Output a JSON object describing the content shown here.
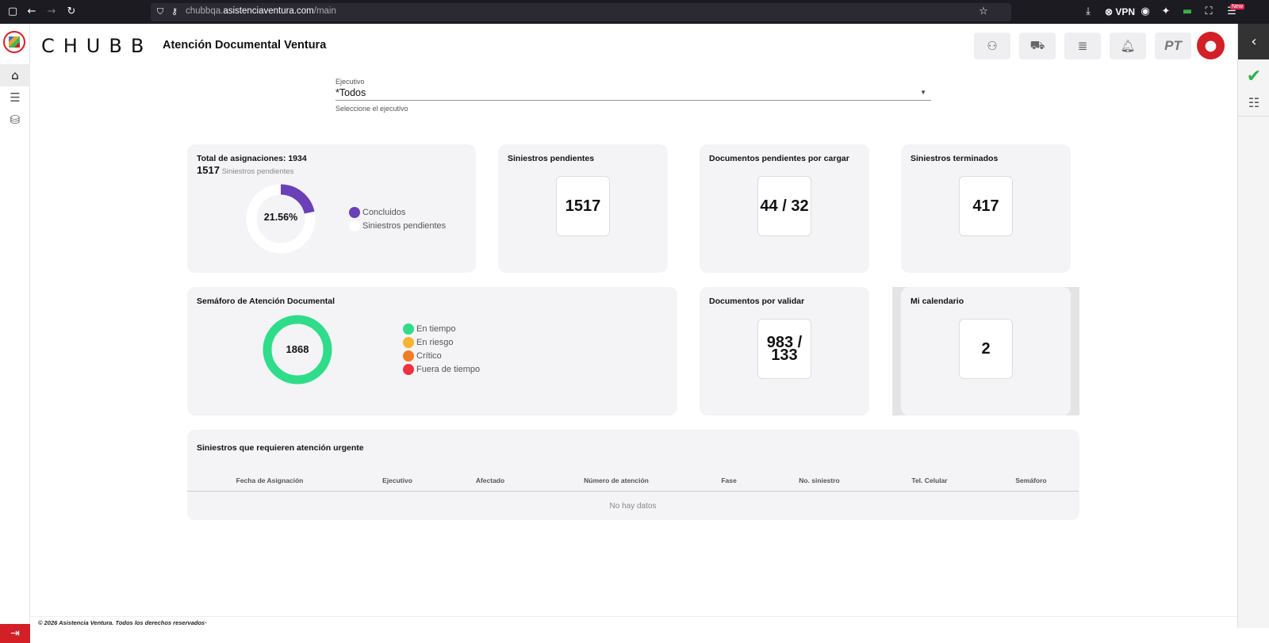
{
  "browser": {
    "url_prefix": "chubbqa.",
    "url_domain": "asistenciaventura.com",
    "url_path": "/main",
    "vpn_label": "VPN",
    "new_badge": "New"
  },
  "header": {
    "logo_text": "CHUBB",
    "app_title": "Atención Documental Ventura",
    "user_initials": "PT"
  },
  "filter": {
    "label": "Ejecutivo",
    "value": "*Todos",
    "hint": "Seleccione el ejecutivo"
  },
  "assignments": {
    "title": "Total de asignaciones: 1934",
    "pending_count": "1517",
    "pending_label": "Siniestros pendientes",
    "percent_label": "21.56%",
    "percent_value": 21.56,
    "legend": [
      {
        "label": "Concluidos",
        "color": "#6a3fb8"
      },
      {
        "label": "Siniestros pendientes",
        "color": "#ffffff"
      }
    ]
  },
  "kpis": {
    "pending_claims": {
      "title": "Siniestros pendientes",
      "value": "1517"
    },
    "docs_to_upload": {
      "title": "Documentos pendientes por cargar",
      "value": "44 / 32"
    },
    "finished_claims": {
      "title": "Siniestros terminados",
      "value": "417"
    },
    "docs_to_validate": {
      "title": "Documentos por validar",
      "value_line1": "983 /",
      "value_line2": "133"
    },
    "calendar": {
      "title": "Mi calendario",
      "value": "2"
    }
  },
  "semaforo": {
    "title": "Semáforo de Atención Documental",
    "total": "1868",
    "legend": [
      {
        "label": "En tiempo",
        "color": "#2fdc8a"
      },
      {
        "label": "En riesgo",
        "color": "#f5b431"
      },
      {
        "label": "Crítico",
        "color": "#ef7d22"
      },
      {
        "label": "Fuera de tiempo",
        "color": "#ef3340"
      }
    ],
    "ring_color": "#2fdc8a"
  },
  "urgent_table": {
    "title": "Siniestros que requieren atención urgente",
    "columns": [
      "Fecha de Asignación",
      "Ejecutivo",
      "Afectado",
      "Número de atención",
      "Fase",
      "No. siniestro",
      "Tel. Celular",
      "Semáforo"
    ],
    "empty_text": "No hay datos"
  },
  "footer": {
    "text": "© 2026 Asistencia Ventura. Todos los derechos reservados·"
  },
  "colors": {
    "brand_red": "#d31f26",
    "accent_purple": "#6a3fb8",
    "check_green": "#2bb34a"
  }
}
